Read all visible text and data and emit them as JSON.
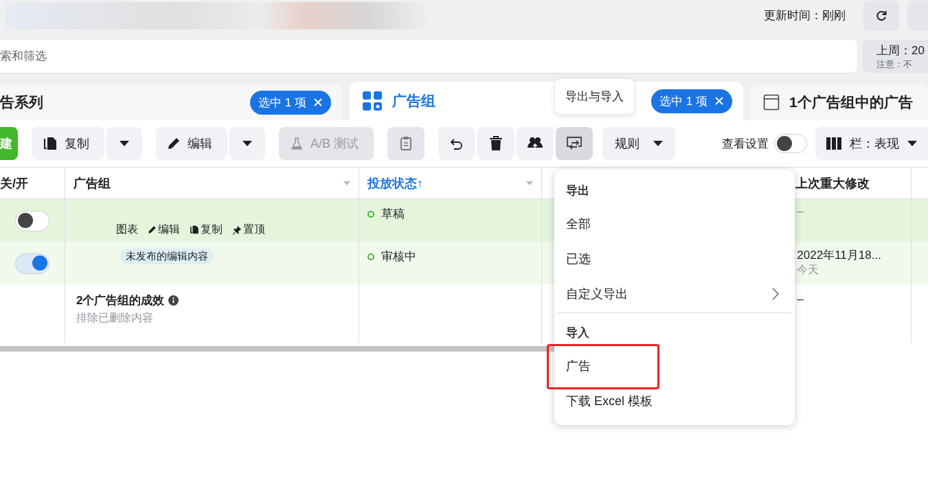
{
  "header": {
    "update_label": "更新时间：刚刚"
  },
  "search": {
    "placeholder": "索和筛选"
  },
  "date_box": {
    "range": "上周：20",
    "note": "注意：不"
  },
  "tabs": [
    {
      "label": "告系列",
      "selected": false,
      "badge": "选中 1 项"
    },
    {
      "label": "广告组",
      "selected": true,
      "badge": "选中 1 项"
    },
    {
      "label": "1个广告组中的广告",
      "selected": false
    }
  ],
  "tooltip": "导出与导入",
  "toolbar": [
    [
      {
        "kind": "create",
        "label": "建",
        "disabled": false,
        "pressed": false
      }
    ],
    [
      {
        "kind": "copy",
        "label": "复制",
        "disabled": false,
        "pressed": false
      },
      {
        "kind": "caret",
        "disabled": false,
        "pressed": false
      }
    ],
    [
      {
        "kind": "edit",
        "label": "编辑",
        "disabled": false,
        "pressed": false
      },
      {
        "kind": "caret",
        "disabled": false,
        "pressed": false
      }
    ],
    [
      {
        "kind": "abtest",
        "label": "A/B 测试",
        "disabled": true,
        "pressed": false
      }
    ],
    [
      {
        "kind": "paste",
        "disabled": true,
        "pressed": false
      }
    ],
    [
      {
        "kind": "undo",
        "disabled": false,
        "pressed": false
      },
      {
        "kind": "delete",
        "disabled": false,
        "pressed": false
      },
      {
        "kind": "people",
        "disabled": false,
        "pressed": false
      },
      {
        "kind": "export",
        "disabled": false,
        "pressed": true
      }
    ],
    [
      {
        "kind": "rules",
        "label": "规则",
        "disabled": false,
        "pressed": false
      }
    ]
  ],
  "view_settings": {
    "label": "查看设置",
    "on": false
  },
  "columns_button": {
    "label": "栏：表现"
  },
  "table": {
    "columns": [
      {
        "label": "关/开",
        "sorted": false,
        "menu": false
      },
      {
        "label": "广告组",
        "sorted": false,
        "menu": true
      },
      {
        "label": "投放状态",
        "sorted": true,
        "sort_arrow": "↑",
        "menu": true
      },
      {
        "label": "上次重大修改",
        "sorted": false,
        "menu": false
      }
    ],
    "rows": [
      {
        "selected": true,
        "on": false,
        "actions": [
          "图表",
          "编辑",
          "复制",
          "置顶"
        ],
        "status": "草稿",
        "last_change": "–"
      },
      {
        "selected": false,
        "on": true,
        "badge": "未发布的编辑内容",
        "status": "审核中",
        "last_change": "2022年11月18...",
        "last_change_note": "今天"
      }
    ],
    "summary": {
      "title": "2个广告组的成效",
      "subtitle": "排除已删除内容",
      "last_change": "–"
    }
  },
  "menu": {
    "sections": [
      {
        "heading": "导出",
        "items": [
          {
            "label": "全部",
            "submenu": false,
            "highlighted": false
          },
          {
            "label": "已选",
            "submenu": false,
            "highlighted": false
          },
          {
            "label": "自定义导出",
            "submenu": true,
            "highlighted": false
          }
        ]
      },
      {
        "heading": "导入",
        "items": [
          {
            "label": "广告",
            "submenu": false,
            "highlighted": true
          },
          {
            "label": "下载 Excel 模板",
            "submenu": false,
            "highlighted": false
          }
        ]
      }
    ]
  }
}
